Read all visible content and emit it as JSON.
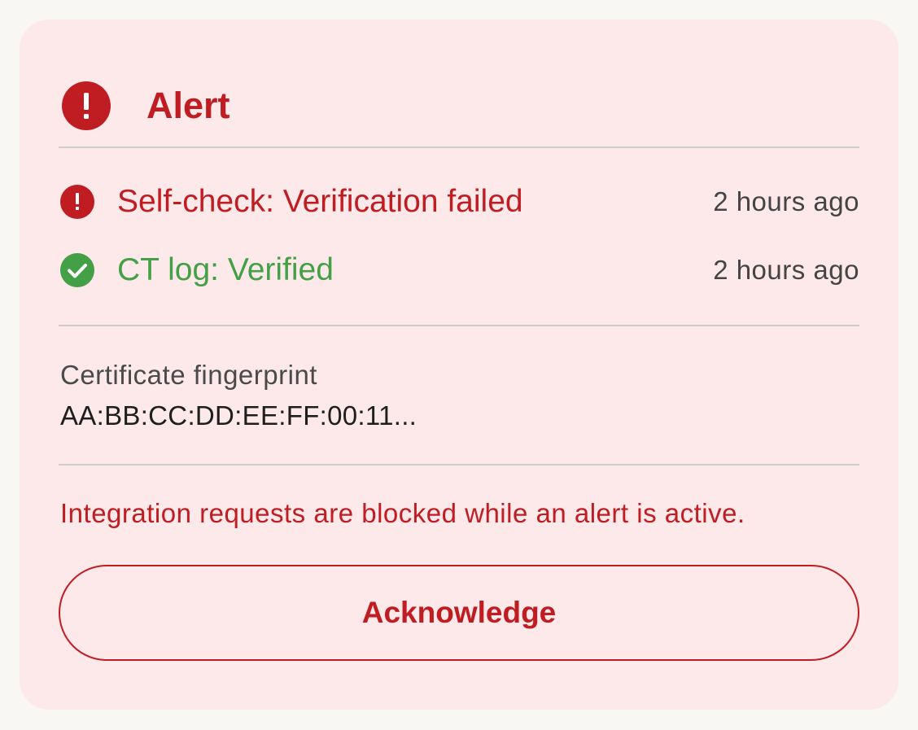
{
  "alert": {
    "title": "Alert",
    "icon": "alert-exclamation-icon",
    "color": "#c01d22"
  },
  "events": [
    {
      "label": "Self-check: Verification failed",
      "time": "2 hours ago",
      "status": "failed",
      "icon": "error-exclamation-icon",
      "color": "#c01d22"
    },
    {
      "label": "CT log: Verified",
      "time": "2 hours ago",
      "status": "verified",
      "icon": "check-circle-icon",
      "color": "#43a047"
    }
  ],
  "fingerprint": {
    "label": "Certificate fingerprint",
    "value": "AA:BB:CC:DD:EE:FF:00:11..."
  },
  "warning_text": "Integration requests are blocked while an alert is active.",
  "acknowledge_label": "Acknowledge"
}
